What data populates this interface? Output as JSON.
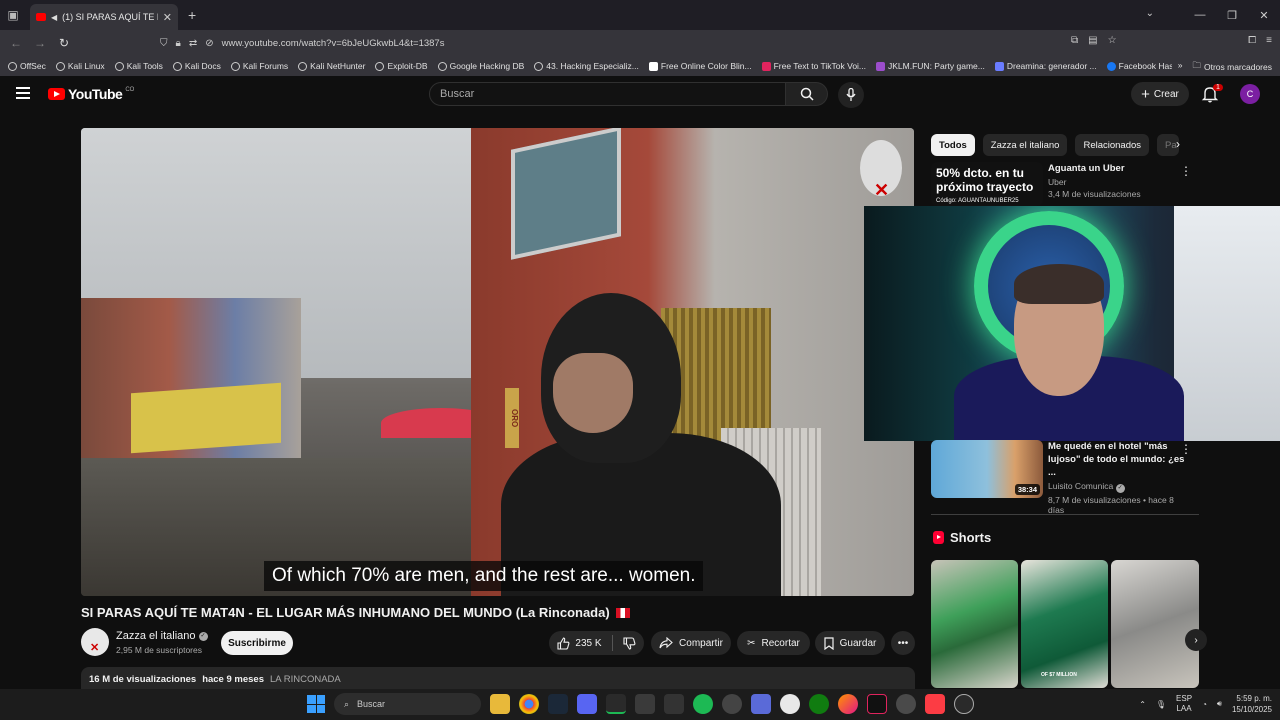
{
  "browser": {
    "tab_title": "(1) SI PARAS AQUÍ TE MAT4",
    "url": "www.youtube.com/watch?v=6bJeUGkwbL4&t=1387s",
    "bookmarks": [
      "OffSec",
      "Kali Linux",
      "Kali Tools",
      "Kali Docs",
      "Kali Forums",
      "Kali NetHunter",
      "Exploit-DB",
      "Google Hacking DB",
      "43. Hacking Especializ...",
      "Free Online Color Blin...",
      "Free Text to TikTok Voi...",
      "JKLM.FUN: Party game...",
      "Dreamina: generador ...",
      "Facebook Hashtag Ge..."
    ],
    "other_bookmarks": "Otros marcadores"
  },
  "youtube": {
    "logo_text": "YouTube",
    "logo_country": "CO",
    "search_placeholder": "Buscar",
    "create_label": "Crear",
    "notifications_count": "1",
    "avatar_letter": "C"
  },
  "video": {
    "subtitle": "Of which 70% are men, and the rest are... women.",
    "sign_text": "ORO",
    "title": "SI PARAS AQUÍ TE MAT4N - EL LUGAR MÁS INHUMANO DEL MUNDO (La Rinconada)",
    "channel_name": "Zazza el italiano",
    "subscribers": "2,95 M de suscriptores",
    "subscribe_label": "Suscribirme",
    "likes": "235 K",
    "share_label": "Compartir",
    "clip_label": "Recortar",
    "save_label": "Guardar",
    "views": "16 M de visualizaciones",
    "age": "hace 9 meses",
    "hashtag": "LA RINCONADA"
  },
  "sidebar": {
    "chips": [
      "Todos",
      "Zazza el italiano",
      "Relacionados",
      "Pa"
    ],
    "recs": [
      {
        "thumb_text": "50% dcto. en tu próximo trayecto",
        "thumb_code": "Código: AGUANTAUNUBER25",
        "title": "Aguanta un Uber",
        "channel": "Uber",
        "views": "3,4 M de visualizaciones"
      },
      {
        "title": "Me quedé en el hotel \"más lujoso\" de todo el mundo: ¿es ...",
        "channel": "Luisito Comunica",
        "views": "8,7 M de visualizaciones • hace 8 días",
        "duration": "38:34"
      }
    ],
    "shorts_heading": "Shorts",
    "short2_caption": "OF $7 MILLION"
  },
  "taskbar": {
    "search_label": "Buscar",
    "lang_top": "ESP",
    "lang_bottom": "LAA",
    "time": "5:59 p. m.",
    "date": "15/10/2025"
  },
  "colors": {
    "background": "#0f0f0f",
    "brand_red": "#ff0000",
    "chip_selected": "#f1f1f1"
  }
}
